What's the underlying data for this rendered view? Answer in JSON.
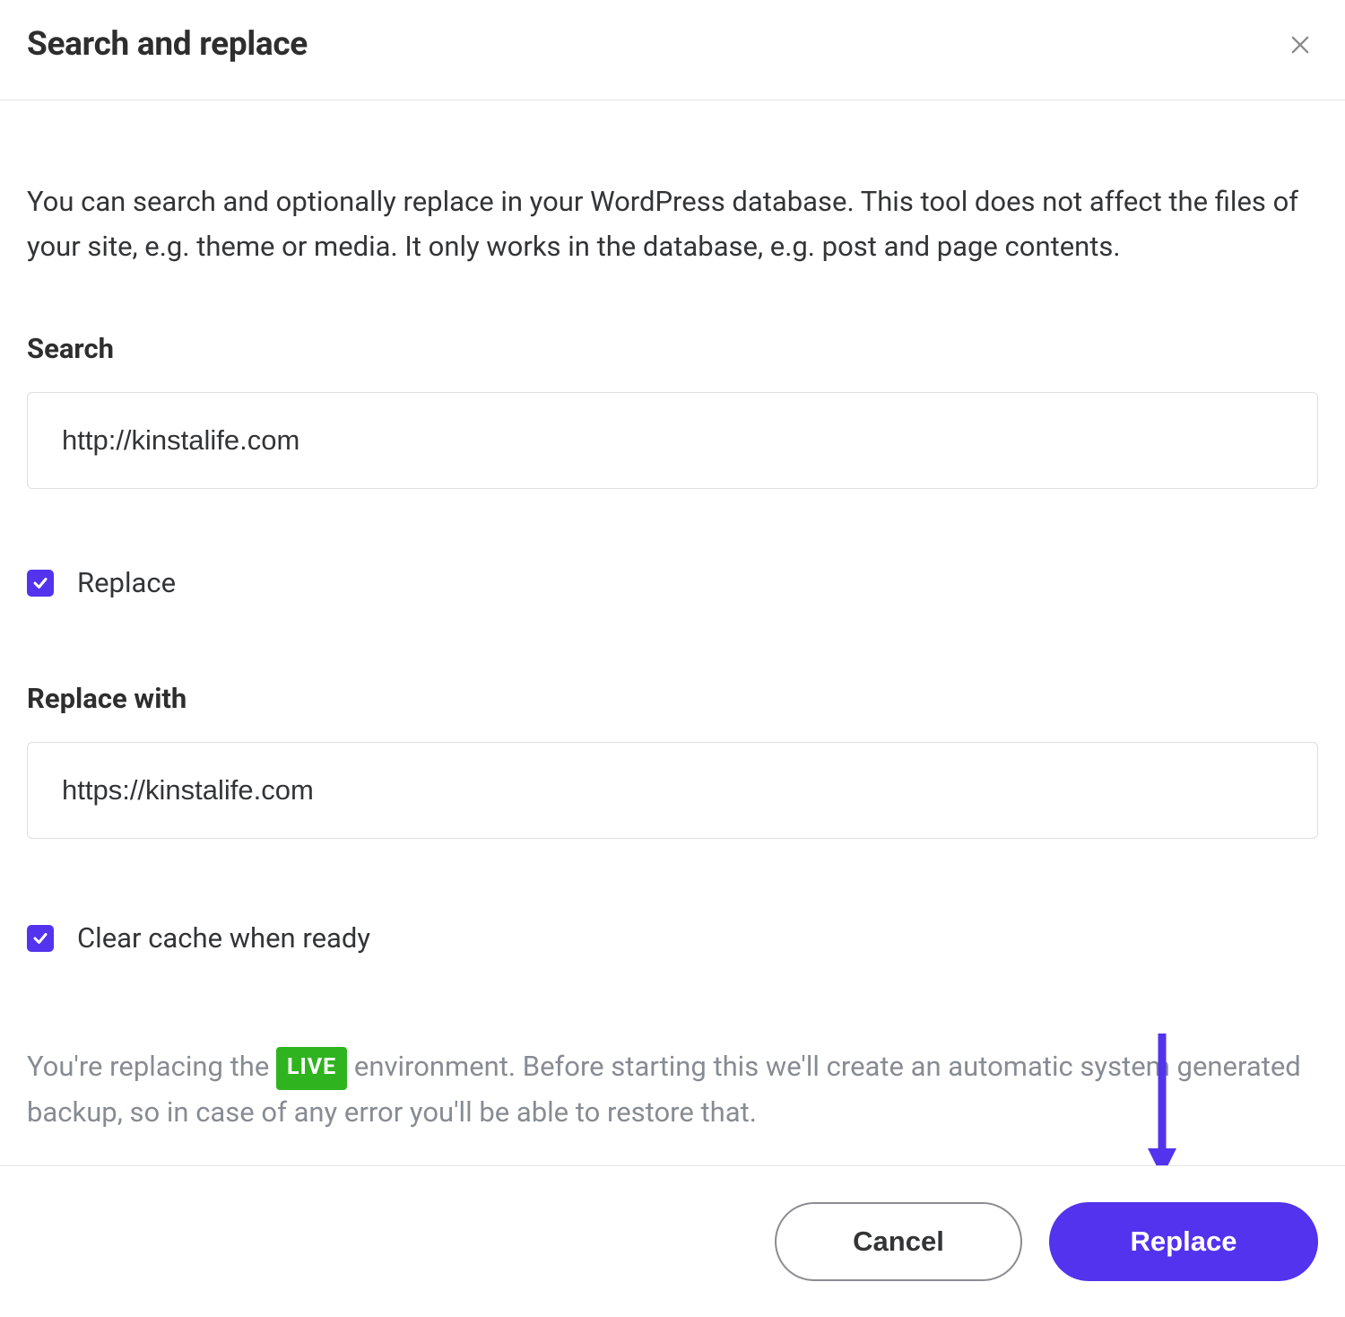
{
  "header": {
    "title": "Search and replace"
  },
  "body": {
    "description": "You can search and optionally replace in your WordPress database. This tool does not affect the files of your site, e.g. theme or media. It only works in the database, e.g. post and page contents.",
    "search_label": "Search",
    "search_value": "http://kinstalife.com",
    "replace_checkbox_label": "Replace",
    "replace_with_label": "Replace with",
    "replace_with_value": "https://kinstalife.com",
    "clear_cache_label": "Clear cache when ready",
    "warn_pre": "You're replacing the ",
    "live_badge": "LIVE",
    "warn_post": " environment. Before starting this we'll create an automatic system generated backup, so in case of any error you'll be able to restore that."
  },
  "footer": {
    "cancel_label": "Cancel",
    "replace_label": "Replace"
  }
}
